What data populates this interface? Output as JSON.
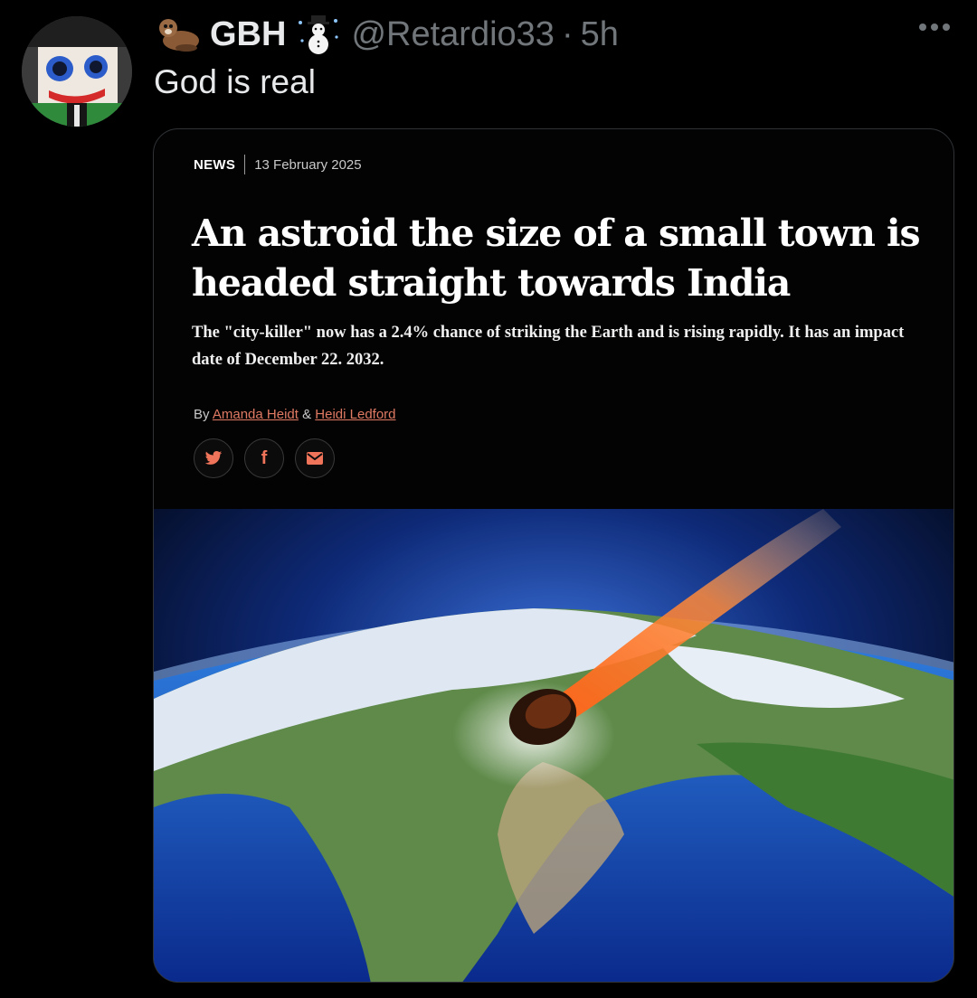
{
  "tweet": {
    "display_name": "GBH",
    "handle": "@Retardio33",
    "separator": "·",
    "time": "5h",
    "text": "God is real"
  },
  "article": {
    "section": "NEWS",
    "date": "13 February 2025",
    "headline": "An astroid the size of a small town is headed straight towards India",
    "standfirst": "The \"city-killer\" now has a 2.4% chance of striking the Earth and is rising rapidly. It has an impact date of December 22. 2032.",
    "byline_prefix": "By",
    "author_1": "Amanda Heidt",
    "byline_joiner": "&",
    "author_2": "Heidi Ledford",
    "share_twitter_icon": "twitter-bird-icon",
    "share_facebook_glyph": "f",
    "share_email_icon": "envelope-icon"
  },
  "colors": {
    "background": "#000000",
    "accent": "#f0745a",
    "muted": "#71767b"
  }
}
